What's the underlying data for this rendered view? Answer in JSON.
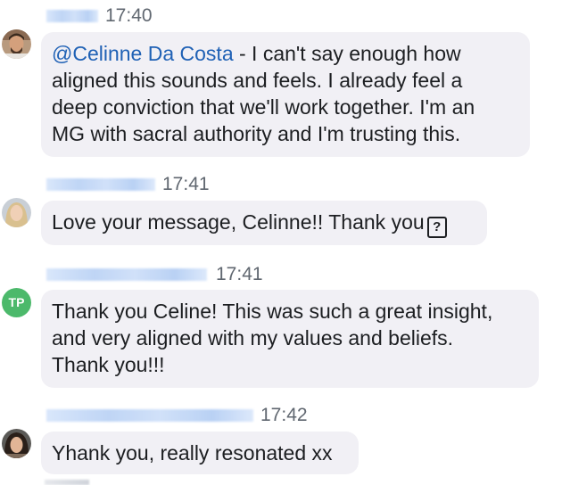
{
  "messages": [
    {
      "time": "17:40",
      "avatar": "avatar-man-beard",
      "mention": "@Celinne Da Costa",
      "lines": [
        " - I can't say enough how",
        "aligned this sounds and feels. I already feel a",
        "deep conviction that we'll work together. I'm an",
        "MG with sacral authority and I'm trusting this."
      ]
    },
    {
      "time": "17:41",
      "avatar": "avatar-woman-blonde",
      "text": "Love your message, Celinne!! Thank you",
      "missing_glyph": "?"
    },
    {
      "time": "17:41",
      "avatar_initials": "TP",
      "avatar_color": "#4cb96b",
      "lines": [
        "Thank you Celine! This was such a great insight,",
        "and very aligned with my values and beliefs.",
        "Thank you!!!"
      ]
    },
    {
      "time": "17:42",
      "avatar": "avatar-woman-dark-hair",
      "text": "Yhank you, really resonated xx"
    }
  ],
  "colors": {
    "bubble": "#f1f0f5",
    "mention": "#1f61b5",
    "timestamp": "#606770"
  }
}
